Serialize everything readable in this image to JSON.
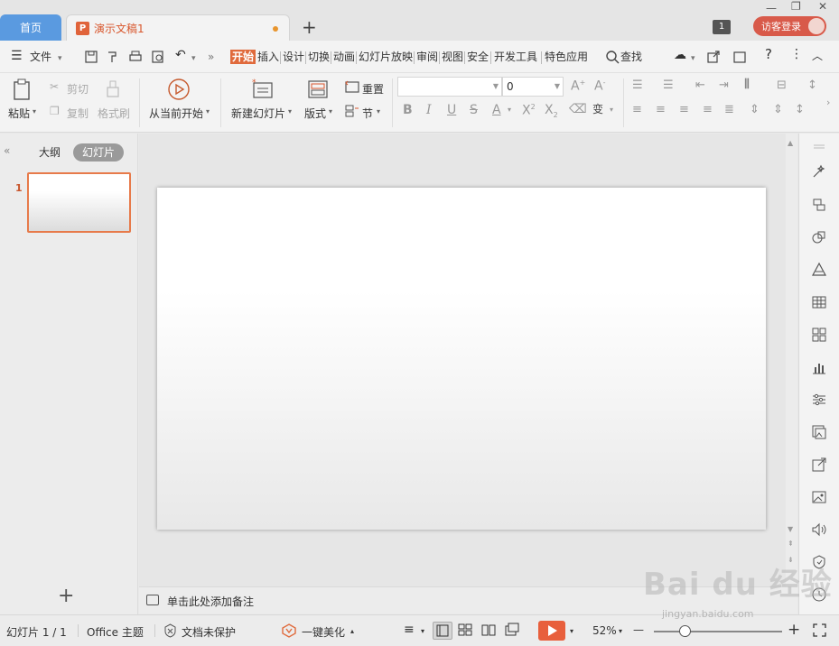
{
  "tabs": {
    "home": "首页",
    "doc": "演示文稿1",
    "new_tab": "+"
  },
  "window": {
    "minimize": "—",
    "restore": "❐",
    "close": "✕",
    "badge": "1",
    "login": "访客登录"
  },
  "menu": {
    "file": "文件",
    "items": [
      "开始",
      "插入",
      "设计",
      "切换",
      "动画",
      "幻灯片放映",
      "审阅",
      "视图",
      "安全",
      "开发工具",
      "特色应用"
    ],
    "search": "查找"
  },
  "ribbon": {
    "paste": "粘贴",
    "cut": "剪切",
    "copy": "复制",
    "format_painter": "格式刷",
    "start_from_current": "从当前开始",
    "new_slide": "新建幻灯片",
    "layout": "版式",
    "reset": "重置",
    "section": "节",
    "font_name": "",
    "font_size": "0"
  },
  "left_panel": {
    "outline_tab": "大纲",
    "slides_tab": "幻灯片",
    "slide_number": "1",
    "add": "+"
  },
  "notes": {
    "placeholder": "单击此处添加备注"
  },
  "status": {
    "slide_count": "幻灯片 1 / 1",
    "theme": "Office 主题",
    "protection": "文档未保护",
    "beautify": "一键美化",
    "zoom": "52%",
    "zoom_minus": "—",
    "zoom_plus": "+"
  },
  "watermark": {
    "logo": "Bai du 经验",
    "url": "jingyan.baidu.com"
  },
  "colors": {
    "accent": "#e06a3c",
    "home_tab": "#5a9ae0",
    "login": "#d85a4a"
  }
}
